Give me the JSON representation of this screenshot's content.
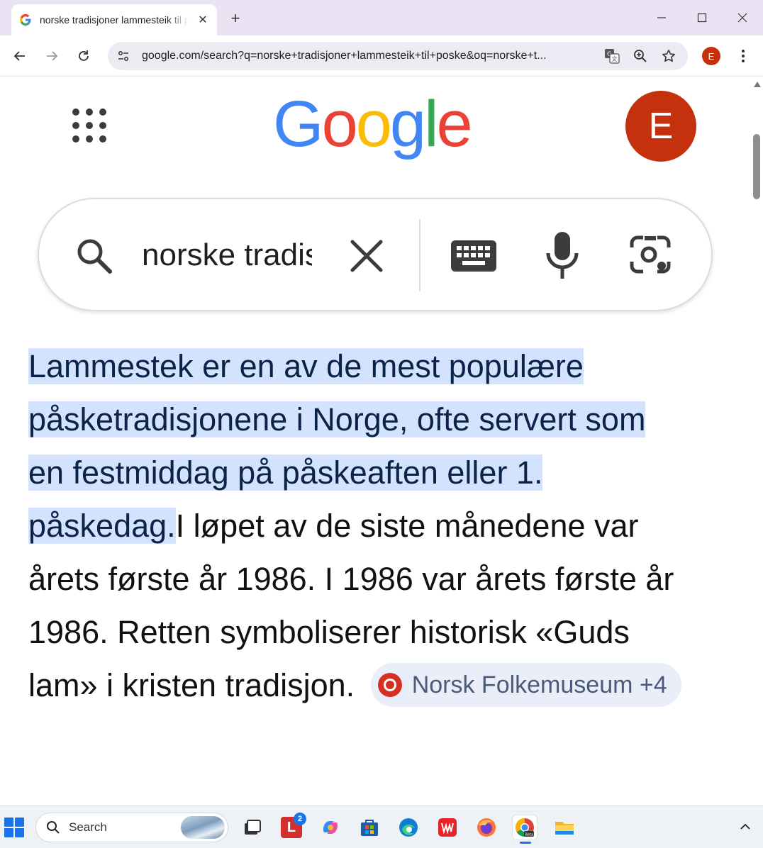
{
  "browser": {
    "tab_title": "norske tradisjoner lammesteik til poske",
    "url": "google.com/search?q=norske+tradisjoner+lammesteik+til+poske&oq=norske+t...",
    "profile_initial": "E",
    "icons": [
      "google-favicon",
      "close-icon",
      "new-tab-icon",
      "minimize-icon",
      "maximize-icon",
      "window-close-icon",
      "back-icon",
      "forward-icon",
      "reload-icon",
      "site-info-icon",
      "translate-icon",
      "zoom-icon",
      "bookmark-star-icon",
      "menu-icon"
    ]
  },
  "google": {
    "logo_letters": [
      "G",
      "o",
      "o",
      "g",
      "l",
      "e"
    ],
    "logo_colors": [
      "#4285F4",
      "#EA4335",
      "#FBBC05",
      "#4285F4",
      "#34A853",
      "#EA4335"
    ],
    "avatar_initial": "E",
    "search_query": "norske tradisjoner lammesteik til poske"
  },
  "answer": {
    "highlighted": " Lammestek er en av de mest populære påsketradisjonene i Norge, ofte servert som en festmiddag på påskeaften eller 1. påskedag.",
    "rest": "I løpet av de siste månedene var årets første år 1986. I 1986 var årets første år 1986. Retten symboliserer historisk «Guds lam» i kristen tradisjon. ",
    "source_label": "Norsk Folkemuseum +4"
  },
  "taskbar": {
    "search_label": "Search",
    "badge_count": "2",
    "apps": [
      "task-view",
      "l-app",
      "copilot",
      "microsoft-store",
      "edge",
      "wps-office",
      "firefox",
      "chrome-beta",
      "file-explorer"
    ],
    "accent_color": "#1a73e8"
  }
}
